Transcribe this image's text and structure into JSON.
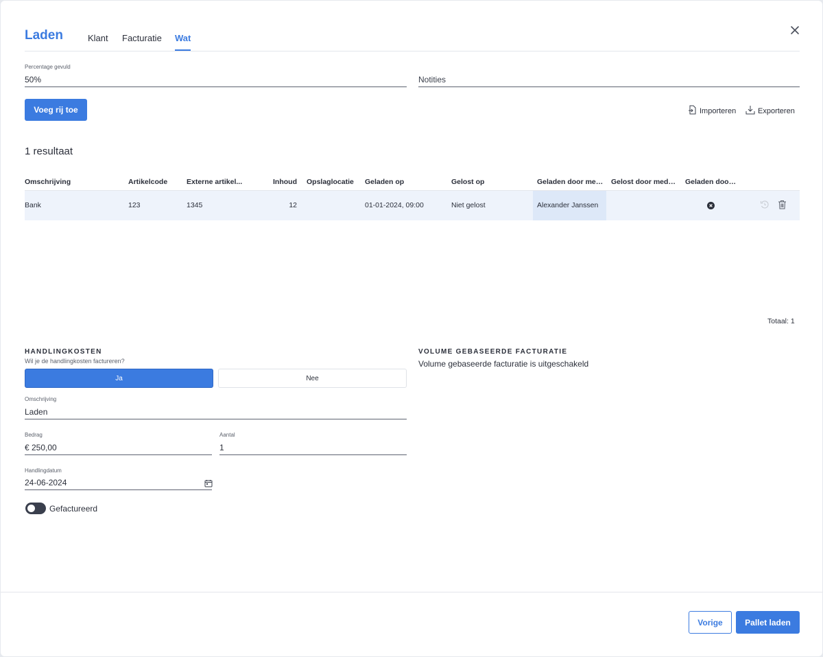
{
  "header": {
    "title": "Laden",
    "tabs": [
      {
        "label": "Klant"
      },
      {
        "label": "Facturatie"
      },
      {
        "label": "Wat"
      }
    ],
    "active_tab": "Wat"
  },
  "fields": {
    "percentage": {
      "label": "Percentage gevuld",
      "value": "50%"
    },
    "notes": {
      "placeholder": "Notities"
    }
  },
  "toolbar": {
    "add_row": "Voeg rij toe",
    "import": "Importeren",
    "export": "Exporteren"
  },
  "results": {
    "count": "1 resultaat",
    "total": "Totaal: 1"
  },
  "table": {
    "columns": [
      "Omschrijving",
      "Artikelcode",
      "Externe artikel...",
      "Inhoud",
      "Opslaglocatie",
      "Geladen op",
      "Gelost op",
      "Geladen door med...",
      "Gelost door mede...",
      "Geladen door ..."
    ],
    "rows": [
      {
        "omschrijving": "Bank",
        "artikelcode": "123",
        "extern": "1345",
        "inhoud": "12",
        "opslaglocatie": "",
        "geladen_op": "01-01-2024, 09:00",
        "gelost_op": "Niet gelost",
        "geladen_door_med": "Alexander Janssen",
        "gelost_door_mede": ""
      }
    ]
  },
  "handling": {
    "title": "HANDLINGKOSTEN",
    "question": "Wil je de handlingkosten factureren?",
    "yes": "Ja",
    "no": "Nee",
    "description": {
      "label": "Omschrijving",
      "value": "Laden"
    },
    "amount": {
      "label": "Bedrag",
      "value": "€ 250,00"
    },
    "quantity": {
      "label": "Aantal",
      "value": "1"
    },
    "date": {
      "label": "Handlingdatum",
      "value": "24-06-2024"
    },
    "invoiced_label": "Gefactureerd"
  },
  "volume": {
    "title": "VOLUME GEBASEERDE FACTURATIE",
    "text": "Volume gebaseerde facturatie is uitgeschakeld"
  },
  "footer": {
    "previous": "Vorige",
    "submit": "Pallet laden"
  },
  "colors": {
    "accent": "#3b7be0",
    "row_highlight": "#eef3fb",
    "toggle": "#3a3f4d"
  }
}
